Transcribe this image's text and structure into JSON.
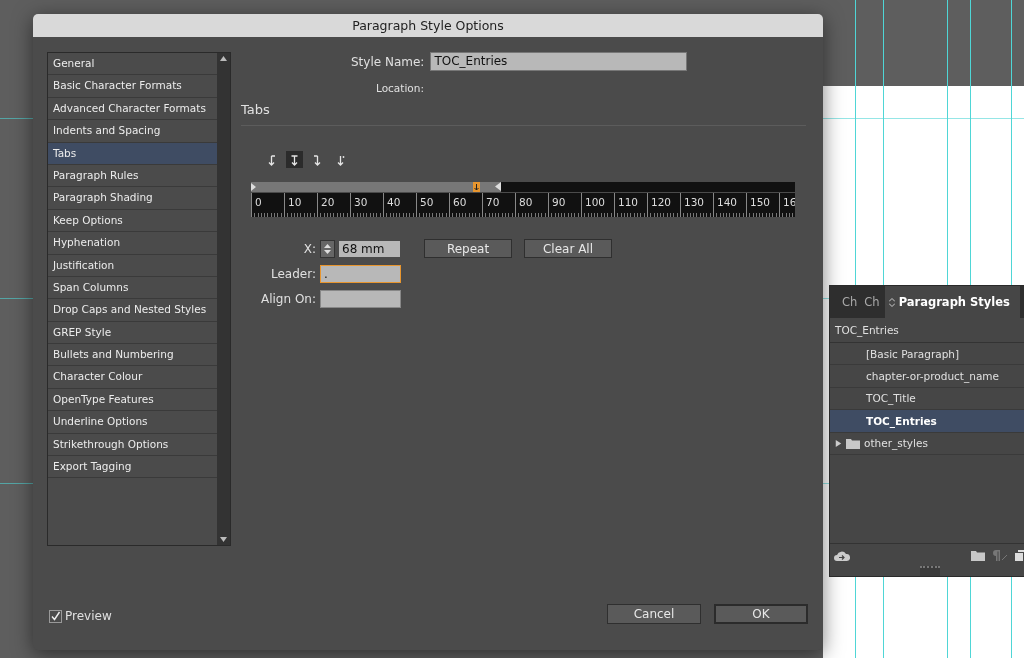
{
  "dialog": {
    "title": "Paragraph Style Options",
    "sidebar": {
      "items": [
        {
          "label": "General",
          "selected": false
        },
        {
          "label": "Basic Character Formats",
          "selected": false
        },
        {
          "label": "Advanced Character Formats",
          "selected": false
        },
        {
          "label": "Indents and Spacing",
          "selected": false
        },
        {
          "label": "Tabs",
          "selected": true
        },
        {
          "label": "Paragraph Rules",
          "selected": false
        },
        {
          "label": "Paragraph Shading",
          "selected": false
        },
        {
          "label": "Keep Options",
          "selected": false
        },
        {
          "label": "Hyphenation",
          "selected": false
        },
        {
          "label": "Justification",
          "selected": false
        },
        {
          "label": "Span Columns",
          "selected": false
        },
        {
          "label": "Drop Caps and Nested Styles",
          "selected": false
        },
        {
          "label": "GREP Style",
          "selected": false
        },
        {
          "label": "Bullets and Numbering",
          "selected": false
        },
        {
          "label": "Character Colour",
          "selected": false
        },
        {
          "label": "OpenType Features",
          "selected": false
        },
        {
          "label": "Underline Options",
          "selected": false
        },
        {
          "label": "Strikethrough Options",
          "selected": false
        },
        {
          "label": "Export Tagging",
          "selected": false
        }
      ]
    },
    "style_name": {
      "label": "Style Name:",
      "value": "TOC_Entries"
    },
    "location": {
      "label": "Location:"
    },
    "section_title": "Tabs",
    "tab_alignment": [
      {
        "kind": "left",
        "selected": false
      },
      {
        "kind": "center",
        "selected": true
      },
      {
        "kind": "right",
        "selected": false
      },
      {
        "kind": "decimal",
        "selected": false
      }
    ],
    "ruler": {
      "tab_stop": {
        "level": 0.414
      },
      "frame_edge": {
        "level": 0.46
      },
      "labels": [
        "0",
        "10",
        "20",
        "30",
        "40",
        "50",
        "60",
        "70",
        "80",
        "90",
        "100",
        "110",
        "120",
        "130",
        "140",
        "150",
        "16"
      ]
    },
    "x_field": {
      "label": "X:",
      "value": "68 mm"
    },
    "leader_field": {
      "label": "Leader:",
      "value": "."
    },
    "align_on_field": {
      "label": "Align On:"
    },
    "buttons": [
      "Repeat",
      "Clear All"
    ],
    "preview": {
      "label": "Preview",
      "checked": true
    },
    "footer_buttons": [
      "Cancel",
      "OK"
    ]
  },
  "panel": {
    "tabs": [
      {
        "label": "Ch",
        "selected": false
      },
      {
        "label": "Ch",
        "selected": false
      },
      {
        "label": "Paragraph Styles",
        "selected": true
      }
    ],
    "current_style": "TOC_Entries",
    "styles": [
      {
        "kind": "style",
        "label": "[Basic Paragraph]",
        "selected": false
      },
      {
        "kind": "style",
        "label": "chapter-or-product_name",
        "selected": false
      },
      {
        "kind": "style",
        "label": "TOC_Title",
        "selected": false
      },
      {
        "kind": "style",
        "label": "TOC_Entries",
        "selected": true
      },
      {
        "kind": "folder",
        "label": "other_styles",
        "selected": false,
        "expanded": false
      }
    ]
  }
}
